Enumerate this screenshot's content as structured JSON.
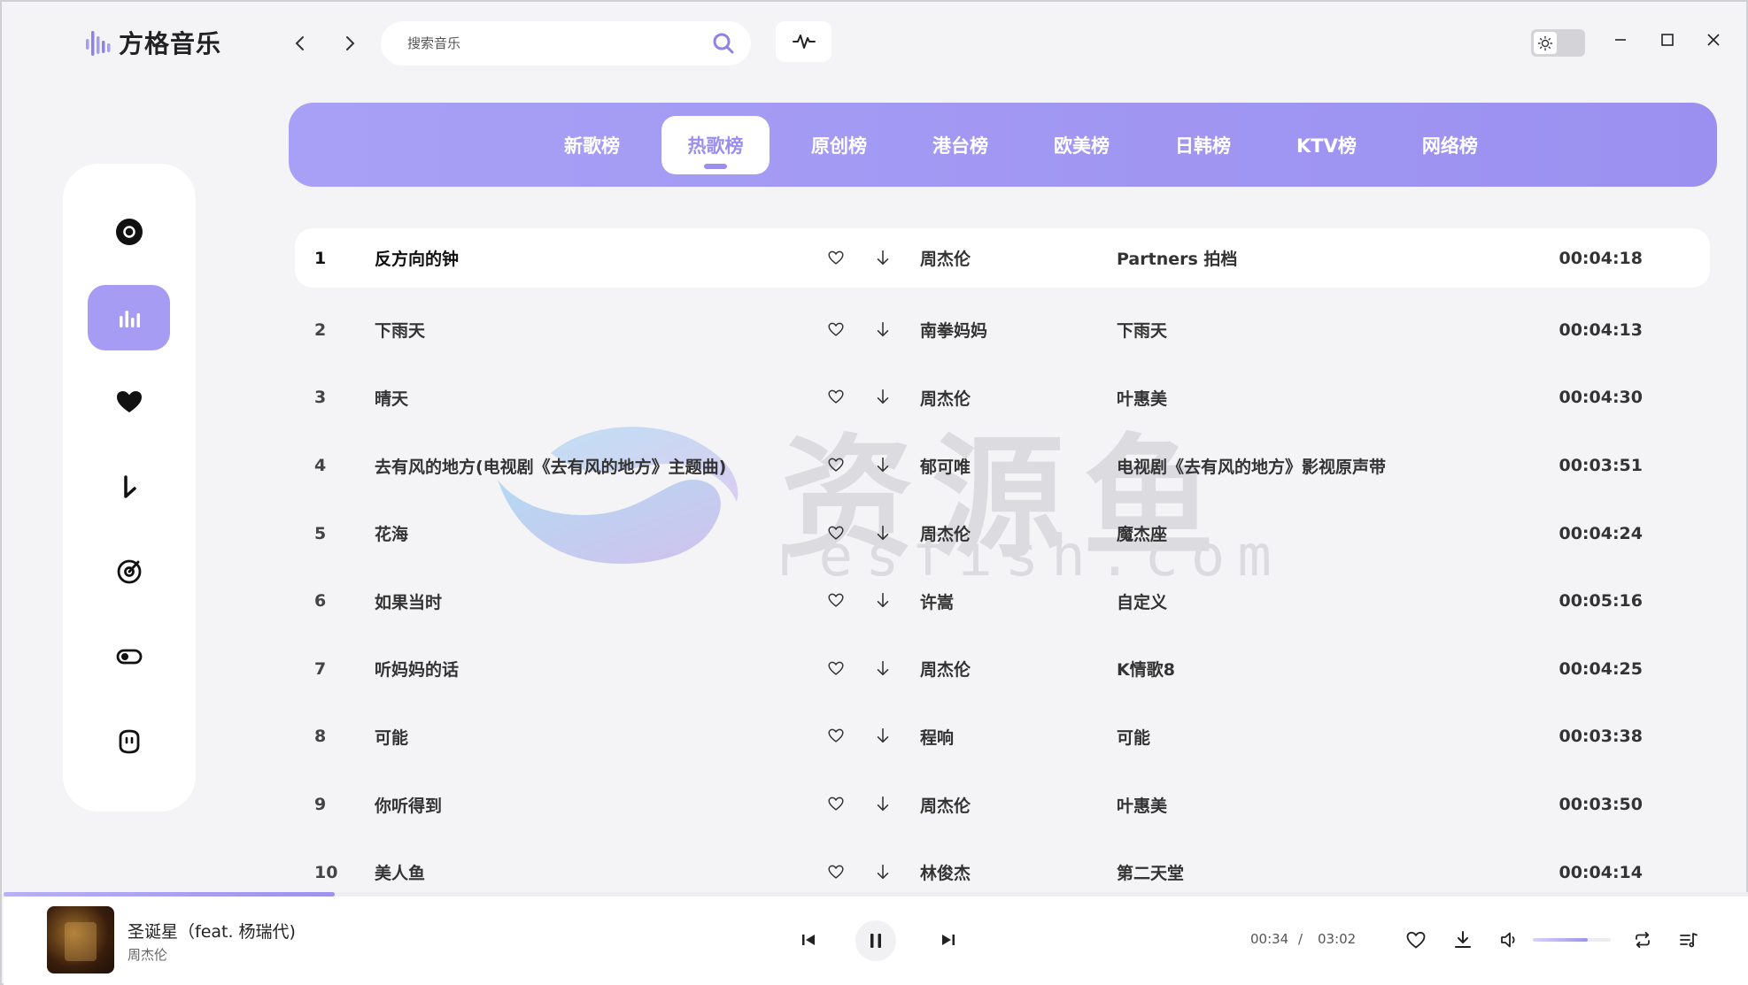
{
  "app": {
    "title": "方格音乐",
    "accent": "#9d92ee"
  },
  "search": {
    "placeholder": "搜索音乐"
  },
  "categories": [
    {
      "label": "新歌榜",
      "active": false
    },
    {
      "label": "热歌榜",
      "active": true
    },
    {
      "label": "原创榜",
      "active": false
    },
    {
      "label": "港台榜",
      "active": false
    },
    {
      "label": "欧美榜",
      "active": false
    },
    {
      "label": "日韩榜",
      "active": false
    },
    {
      "label": "KTV榜",
      "active": false
    },
    {
      "label": "网络榜",
      "active": false
    }
  ],
  "sidebar": {
    "items": [
      {
        "icon": "disc-icon",
        "active": false
      },
      {
        "icon": "chart-bars-icon",
        "active": true
      },
      {
        "icon": "heart-icon",
        "active": false
      },
      {
        "icon": "download-arrow-icon",
        "active": false
      },
      {
        "icon": "radar-icon",
        "active": false
      },
      {
        "icon": "toggle-icon",
        "active": false
      },
      {
        "icon": "face-icon",
        "active": false
      }
    ]
  },
  "songs": [
    {
      "num": "1",
      "title": "反方向的钟",
      "artist": "周杰伦",
      "album": "Partners 拍档",
      "duration": "00:04:18"
    },
    {
      "num": "2",
      "title": "下雨天",
      "artist": "南拳妈妈",
      "album": "下雨天",
      "duration": "00:04:13"
    },
    {
      "num": "3",
      "title": "晴天",
      "artist": "周杰伦",
      "album": "叶惠美",
      "duration": "00:04:30"
    },
    {
      "num": "4",
      "title": "去有风的地方(电视剧《去有风的地方》主题曲)",
      "artist": "郁可唯",
      "album": "电视剧《去有风的地方》影视原声带",
      "duration": "00:03:51"
    },
    {
      "num": "5",
      "title": "花海",
      "artist": "周杰伦",
      "album": "魔杰座",
      "duration": "00:04:24"
    },
    {
      "num": "6",
      "title": "如果当时",
      "artist": "许嵩",
      "album": "自定义",
      "duration": "00:05:16"
    },
    {
      "num": "7",
      "title": "听妈妈的话",
      "artist": "周杰伦",
      "album": "K情歌8",
      "duration": "00:04:25"
    },
    {
      "num": "8",
      "title": "可能",
      "artist": "程响",
      "album": "可能",
      "duration": "00:03:38"
    },
    {
      "num": "9",
      "title": "你听得到",
      "artist": "周杰伦",
      "album": "叶惠美",
      "duration": "00:03:50"
    },
    {
      "num": "10",
      "title": "美人鱼",
      "artist": "林俊杰",
      "album": "第二天堂",
      "duration": "00:04:14"
    }
  ],
  "watermark": {
    "text": "资源鱼",
    "domain": "resfish.com"
  },
  "player": {
    "title": "圣诞星（feat. 杨瑞代)",
    "artist": "周杰伦",
    "current_time": "00:34",
    "separator": "/",
    "total_time": "03:02",
    "progress": 0.19,
    "volume": 0.7
  }
}
